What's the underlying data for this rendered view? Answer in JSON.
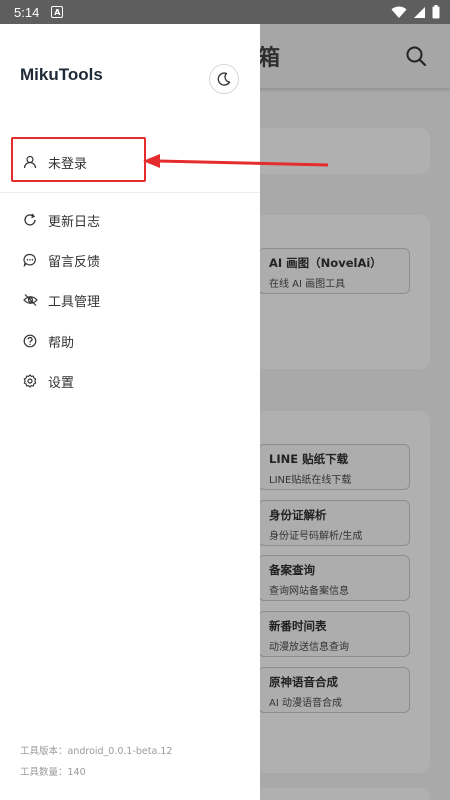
{
  "status_bar": {
    "time": "5:14",
    "notification_icon": "A"
  },
  "background": {
    "title": "箱",
    "tools": [
      {
        "title": "AI 画图（NovelAi）",
        "desc": "在线 AI 画图工具"
      },
      {
        "title": "LINE 贴纸下载",
        "desc": "LINE贴纸在线下载"
      },
      {
        "title": "身份证解析",
        "desc": "身份证号码解析/生成"
      },
      {
        "title": "备案查询",
        "desc": "查询网站备案信息"
      },
      {
        "title": "新番时间表",
        "desc": "动漫放送信息查询"
      },
      {
        "title": "原神语音合成",
        "desc": "AI 动漫语音合成"
      }
    ]
  },
  "drawer": {
    "app_name": "MikuTools",
    "login_label": "未登录",
    "menu": [
      {
        "label": "更新日志",
        "icon": "refresh-icon"
      },
      {
        "label": "留言反馈",
        "icon": "chat-bubble-icon"
      },
      {
        "label": "工具管理",
        "icon": "eye-off-icon"
      },
      {
        "label": "帮助",
        "icon": "help-icon"
      },
      {
        "label": "设置",
        "icon": "gear-icon"
      }
    ],
    "footer": {
      "version": "工具版本：android_0.0.1-beta.12",
      "count": "工具数量：140"
    }
  },
  "colors": {
    "annotation": "#e52b2b",
    "title": "#1f2a37"
  }
}
